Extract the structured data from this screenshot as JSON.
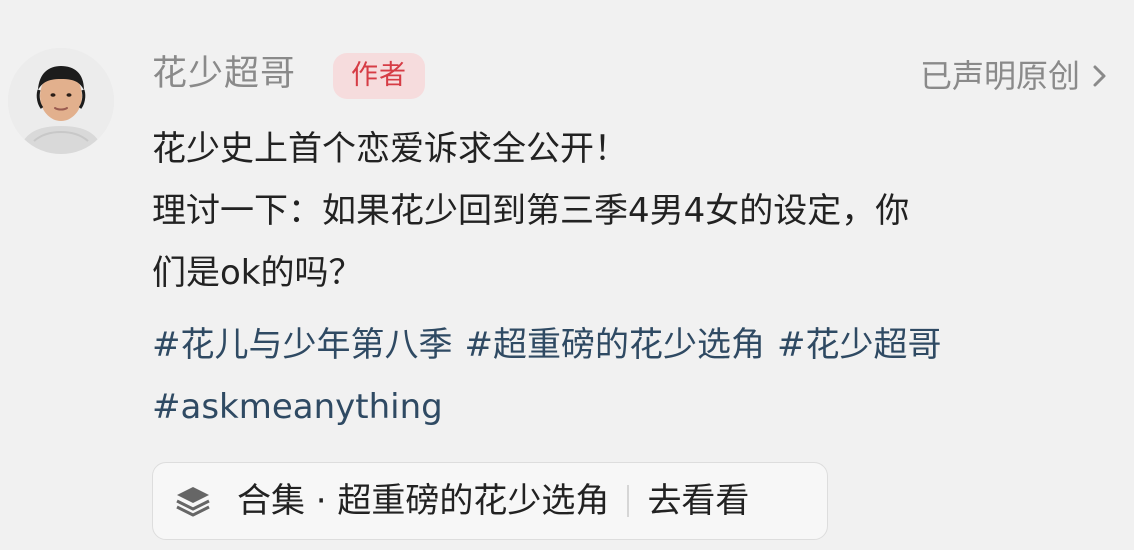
{
  "comment": {
    "author_name": "花少超哥",
    "author_badge": "作者",
    "original_label": "已声明原创",
    "icons": {
      "avatar": "avatar",
      "chevron": "chevron-right-icon"
    },
    "post_lines": [
      "花少史上首个恋爱诉求全公开！",
      "理讨一下：如果花少回到第三季4男4女的设定，你",
      "们是ok的吗？"
    ],
    "hashtags_row1": [
      "#花儿与少年第八季",
      "#超重磅的花少选角",
      "#花少超哥"
    ],
    "hashtags_row2": [
      "#askmeanything"
    ],
    "collection": {
      "title": "合集 · 超重磅的花少选角",
      "action": "去看看",
      "icon": "layers-icon"
    },
    "colors": {
      "background": "#f1f1f1",
      "author_text": "#8a8a8a",
      "badge_bg": "#f6dcdd",
      "badge_text": "#d63c45",
      "body_text": "#222222",
      "hashtag_text": "#2f4a63"
    }
  }
}
